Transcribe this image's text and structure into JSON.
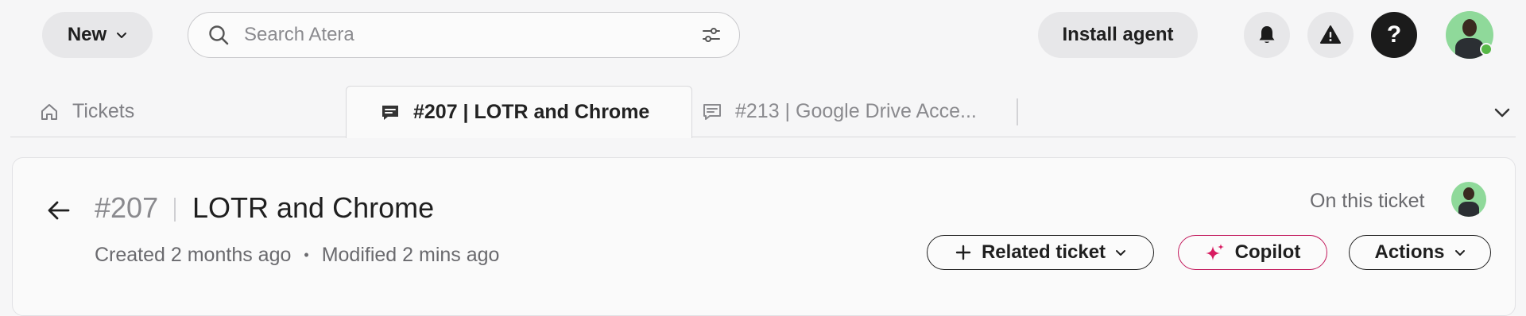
{
  "topbar": {
    "new_label": "New",
    "search_placeholder": "Search Atera",
    "install_label": "Install agent",
    "icons": [
      "bell-icon",
      "alert-icon",
      "help-icon"
    ],
    "help_glyph": "?"
  },
  "tabs": {
    "home_label": "Tickets",
    "active_label": "#207 | LOTR and Chrome",
    "inactive_label": "#213 | Google Drive Acce..."
  },
  "ticket": {
    "number": "#207",
    "title": "LOTR and Chrome",
    "created": "Created 2 months ago",
    "dot": "•",
    "modified": "Modified 2 mins ago",
    "on_ticket_label": "On this ticket",
    "related_label": "Related ticket",
    "copilot_label": "Copilot",
    "actions_label": "Actions"
  },
  "colors": {
    "accent_copilot": "#c2185b",
    "online": "#57b847",
    "avatar_bg": "#8fd99a"
  }
}
